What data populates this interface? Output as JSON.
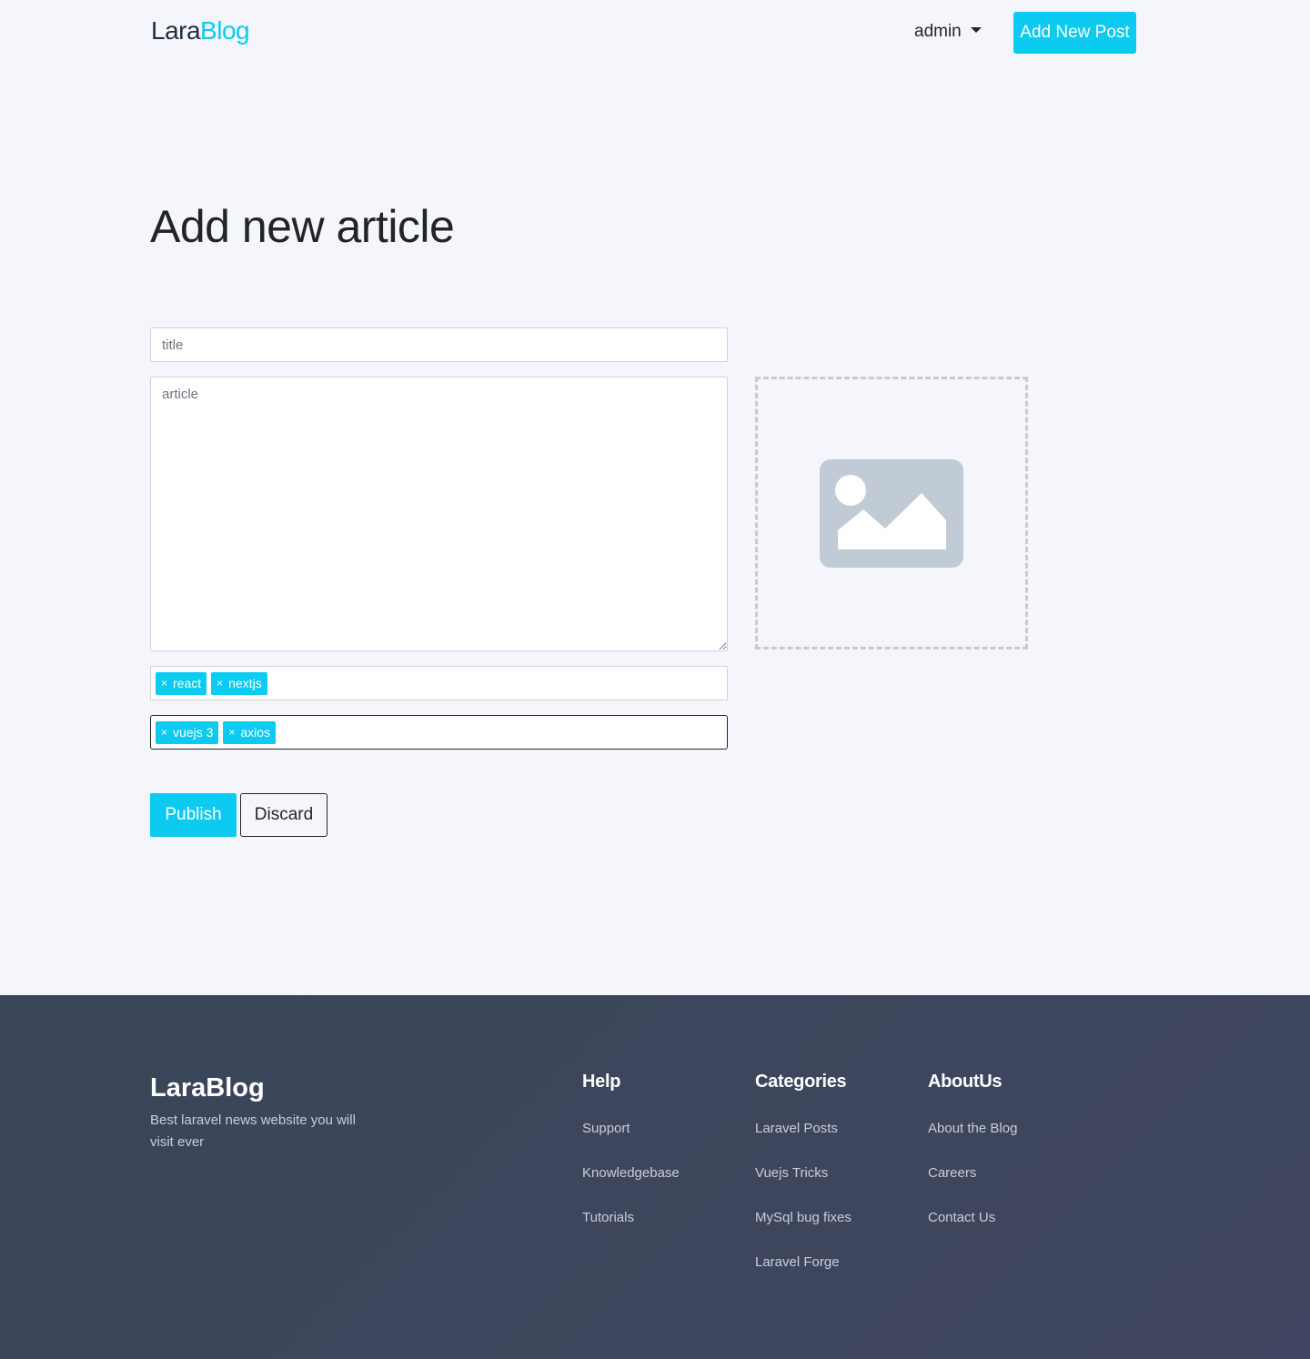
{
  "header": {
    "brand_part1": "Lara",
    "brand_part2": "Blog",
    "user_label": "admin",
    "new_post_label": "Add New Post"
  },
  "main": {
    "page_title": "Add new article",
    "title_placeholder": "title",
    "article_placeholder": "article",
    "tag_group_1": [
      "react",
      "nextjs"
    ],
    "tag_group_2": [
      "vuejs 3",
      "axios"
    ],
    "publish_label": "Publish",
    "discard_label": "Discard"
  },
  "footer": {
    "brand": "LaraBlog",
    "description": "Best laravel news website you will visit ever",
    "help": {
      "heading": "Help",
      "links": [
        "Support",
        "Knowledgebase",
        "Tutorials"
      ]
    },
    "categories": {
      "heading": "Categories",
      "links": [
        "Laravel Posts",
        "Vuejs Tricks",
        "MySql bug fixes",
        "Laravel Forge"
      ]
    },
    "about": {
      "heading": "AboutUs",
      "links": [
        "About the Blog",
        "Careers",
        "Contact Us"
      ]
    }
  },
  "colors": {
    "accent": "#0dcaf0",
    "page_bg": "#f5f6fb",
    "footer_bg": "#3d4559"
  },
  "icons": {
    "tag_remove": "×",
    "image_placeholder": "image-icon",
    "dropdown": "caret-down-icon"
  }
}
